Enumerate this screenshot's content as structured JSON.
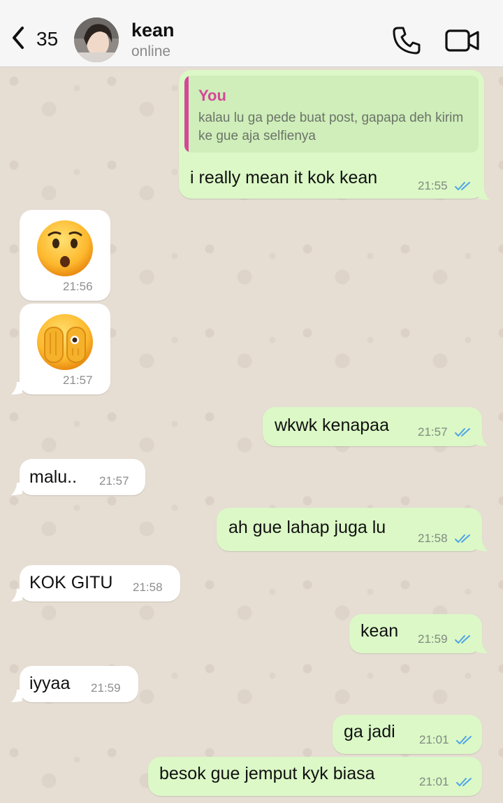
{
  "header": {
    "back_count": "35",
    "contact_name": "kean",
    "contact_status": "online"
  },
  "messages": [
    {
      "direction": "out",
      "quote": {
        "author": "You",
        "text": "kalau lu ga pede buat post, gapapa deh kirim ke gue aja selfienya"
      },
      "text": "i really mean it kok kean",
      "time": "21:55",
      "status": "read"
    },
    {
      "direction": "in",
      "type": "emoji",
      "emoji": "hushed-face",
      "time": "21:56"
    },
    {
      "direction": "in",
      "type": "emoji",
      "emoji": "face-with-peeking-eye",
      "time": "21:57"
    },
    {
      "direction": "out",
      "text": "wkwk kenapaa",
      "time": "21:57",
      "status": "read"
    },
    {
      "direction": "in",
      "text": "malu..",
      "time": "21:57"
    },
    {
      "direction": "out",
      "text": "ah gue lahap juga lu",
      "time": "21:58",
      "status": "read"
    },
    {
      "direction": "in",
      "text": "KOK GITU",
      "time": "21:58"
    },
    {
      "direction": "out",
      "text": "kean",
      "time": "21:59",
      "status": "read"
    },
    {
      "direction": "in",
      "text": "iyyaa",
      "time": "21:59"
    },
    {
      "direction": "out",
      "text": "ga jadi",
      "time": "21:01",
      "status": "read"
    },
    {
      "direction": "out",
      "text": "besok gue jemput kyk biasa",
      "time": "21:01",
      "status": "read"
    }
  ],
  "colors": {
    "outgoing_bubble": "#dbf8c6",
    "incoming_bubble": "#ffffff",
    "read_ticks": "#4fa3e8",
    "quote_accent": "#d4479a"
  }
}
